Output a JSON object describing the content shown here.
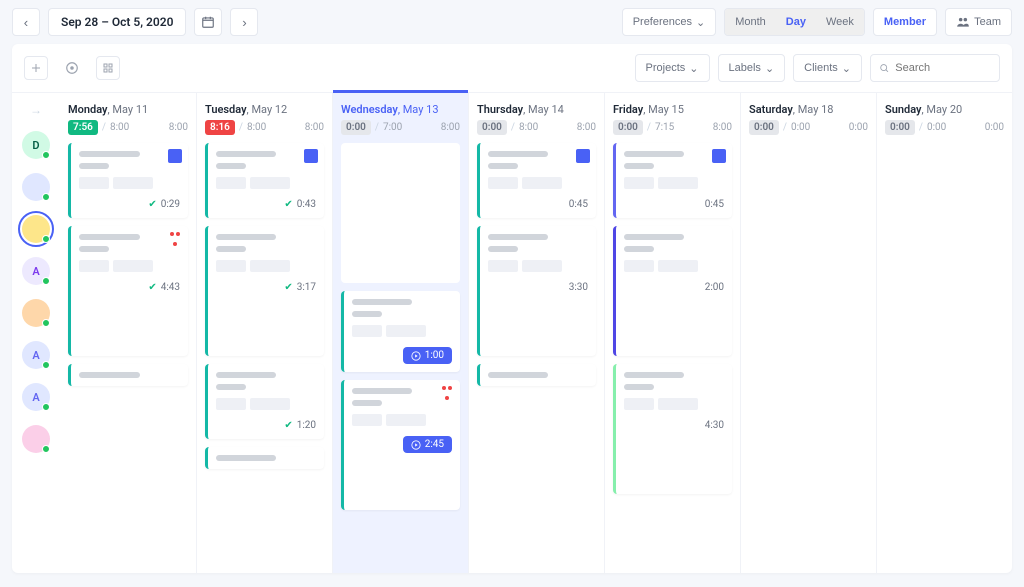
{
  "topbar": {
    "date_range": "Sep 28 – Oct 5, 2020",
    "preferences": "Preferences",
    "views": {
      "month": "Month",
      "day": "Day",
      "week": "Week"
    },
    "member": "Member",
    "team": "Team"
  },
  "filters": {
    "projects": "Projects",
    "labels": "Labels",
    "clients": "Clients"
  },
  "search": {
    "placeholder": "Search"
  },
  "sidebar": {
    "users": [
      {
        "initial": "D",
        "bg": "#d1fae5",
        "color": "#065f46"
      },
      {
        "initial": "",
        "bg": "#e0e7ff",
        "image": true
      },
      {
        "initial": "",
        "bg": "#fde68a",
        "image": true,
        "selected": true
      },
      {
        "initial": "A",
        "bg": "#ede9fe",
        "color": "#7c3aed"
      },
      {
        "initial": "",
        "bg": "#fed7aa",
        "image": true
      },
      {
        "initial": "A",
        "bg": "#e0e7ff",
        "color": "#6366f1"
      },
      {
        "initial": "A",
        "bg": "#e0e7ff",
        "color": "#6366f1"
      },
      {
        "initial": "",
        "bg": "#fbcfe8",
        "image": true
      }
    ]
  },
  "days": [
    {
      "weekday": "Monday",
      "date": "May 11",
      "badge": "7:56",
      "badge_color": "green",
      "plan": "8:00",
      "right": "8:00",
      "cards": [
        {
          "stripe": "teal",
          "icon": "cal",
          "footer_check": true,
          "footer_time": "0:29"
        },
        {
          "stripe": "teal",
          "icon": "tri",
          "tall": true,
          "footer_check": true,
          "footer_time": "4:43"
        },
        {
          "stripe": "teal",
          "short": true
        }
      ]
    },
    {
      "weekday": "Tuesday",
      "date": "May 12",
      "badge": "8:16",
      "badge_color": "red",
      "plan": "8:00",
      "right": "8:00",
      "cards": [
        {
          "stripe": "teal",
          "icon": "cal",
          "footer_check": true,
          "footer_time": "0:43"
        },
        {
          "stripe": "teal",
          "tall": true,
          "footer_check": true,
          "footer_time": "3:17"
        },
        {
          "stripe": "teal",
          "footer_check": true,
          "footer_time": "1:20"
        },
        {
          "stripe": "teal",
          "short": true
        }
      ]
    },
    {
      "weekday": "Wednesday",
      "date": "May 13",
      "today": true,
      "badge": "0:00",
      "badge_color": "gray",
      "plan": "7:00",
      "right": "8:00",
      "cards": [
        {
          "placeholder": true
        },
        {
          "stripe": "teal",
          "footer_pill": "1:00"
        },
        {
          "stripe": "teal",
          "icon": "tri",
          "tall": true,
          "footer_pill": "2:45"
        }
      ]
    },
    {
      "weekday": "Thursday",
      "date": "May 14",
      "badge": "0:00",
      "badge_color": "gray",
      "plan": "8:00",
      "right": "8:00",
      "cards": [
        {
          "stripe": "teal",
          "icon": "cal",
          "footer_time": "0:45"
        },
        {
          "stripe": "teal",
          "tall": true,
          "footer_time": "3:30"
        },
        {
          "stripe": "teal",
          "short": true
        }
      ]
    },
    {
      "weekday": "Friday",
      "date": "May 15",
      "badge": "0:00",
      "badge_color": "gray",
      "plan": "7:15",
      "right": "8:00",
      "cards": [
        {
          "stripe": "blue",
          "icon": "cal",
          "footer_time": "0:45"
        },
        {
          "stripe": "indigo",
          "tall": true,
          "footer_time": "2:00"
        },
        {
          "stripe": "green",
          "tall": true,
          "footer_time": "4:30"
        }
      ]
    },
    {
      "weekday": "Saturday",
      "date": "May 18",
      "badge": "0:00",
      "badge_color": "gray",
      "plan": "0:00",
      "right": "0:00",
      "cards": []
    },
    {
      "weekday": "Sunday",
      "date": "May 20",
      "badge": "0:00",
      "badge_color": "gray",
      "plan": "0:00",
      "right": "0:00",
      "cards": []
    }
  ]
}
